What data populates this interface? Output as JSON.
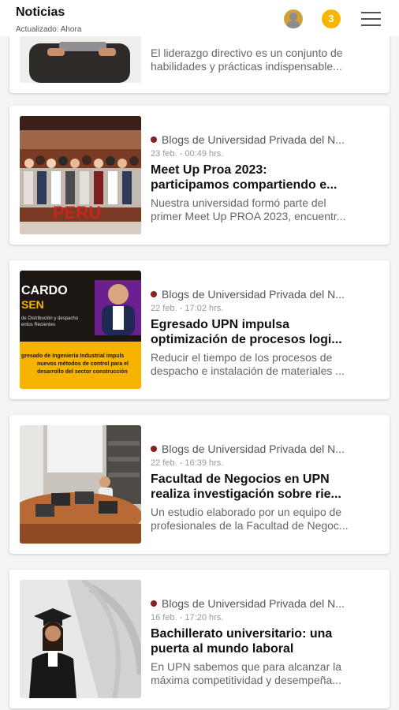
{
  "header": {
    "title": "Noticias",
    "updated": "Actualizado: Ahora",
    "notification_count": "3",
    "avatar_icon": "user-avatar-icon",
    "menu_icon": "hamburger-menu-icon"
  },
  "colors": {
    "badge": "#f7b500",
    "source_dot": "#8b1f1f",
    "background": "#f4f4f4"
  },
  "articles": [
    {
      "summary_lines": [
        "El liderazgo directivo es un conjunto de",
        "habilidades y prácticas indispensable..."
      ]
    },
    {
      "source": "Blogs de Universidad Privada del N...",
      "date": "23 feb. - 00:49 hrs.",
      "title_lines": [
        "Meet Up Proa 2023:",
        "participamos compartiendo e..."
      ],
      "summary_lines": [
        "Nuestra universidad formó parte del",
        "primer Meet Up PROA 2023, encuentr..."
      ],
      "image_text": "PERU"
    },
    {
      "source": "Blogs de Universidad Privada del N...",
      "date": "22 feb. - 17:02 hrs.",
      "title_lines": [
        "Egresado UPN impulsa",
        "optimización de procesos logi..."
      ],
      "summary_lines": [
        "Reducir el tiempo de los procesos de",
        "despacho e instalación de materiales ..."
      ],
      "image_text": [
        "CARDO",
        "SEN",
        "de Distribución y despacho",
        "entos Recientes",
        "gresado de Ingeniería Industrial impuls",
        "nuevos métodos de control para el",
        "desarrollo del sector construcción"
      ]
    },
    {
      "source": "Blogs de Universidad Privada del N...",
      "date": "22 feb. - 16:39 hrs.",
      "title_lines": [
        "Facultad de Negocios en UPN",
        "realiza investigación sobre rie..."
      ],
      "summary_lines": [
        "Un estudio elaborado por un equipo de",
        "profesionales de la Facultad de Negoc..."
      ]
    },
    {
      "source": "Blogs de Universidad Privada del N...",
      "date": "16 feb. - 17:20 hrs.",
      "title_lines": [
        "Bachillerato universitario: una",
        "puerta al mundo laboral"
      ],
      "summary_lines": [
        "En UPN sabemos que para alcanzar la",
        "máxima competitividad y desempeña..."
      ]
    }
  ]
}
